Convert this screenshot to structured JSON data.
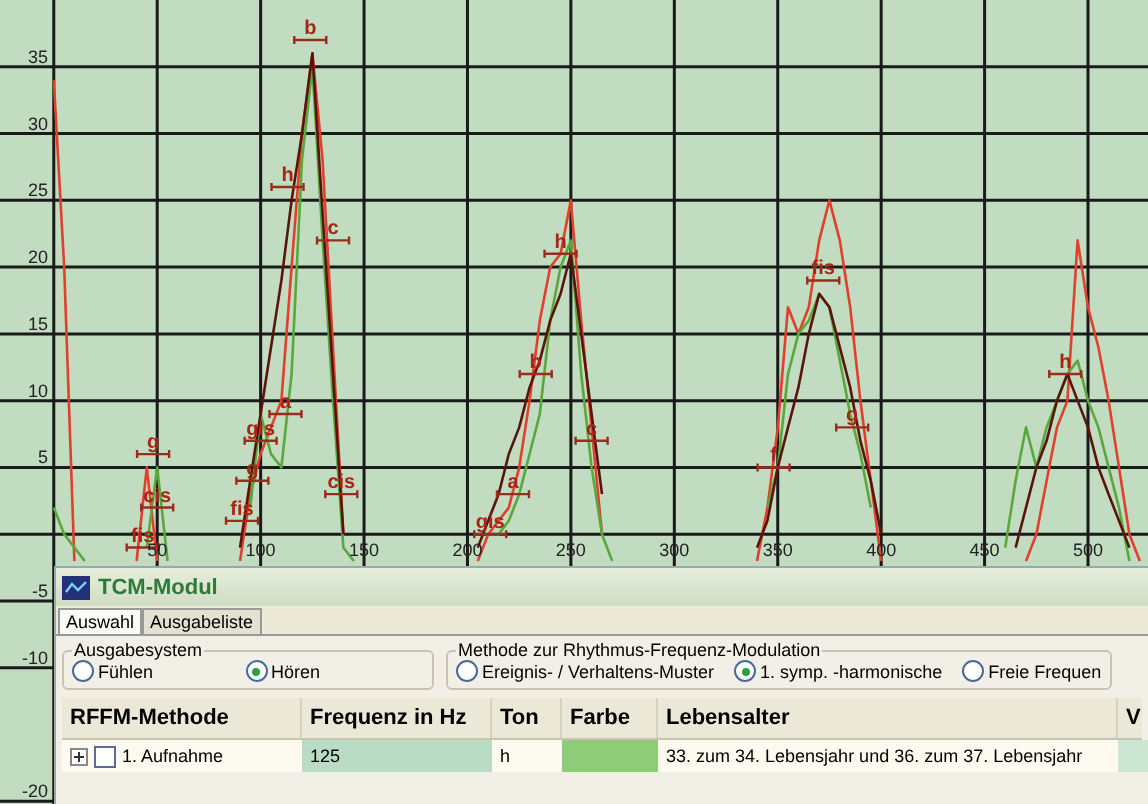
{
  "chart_data": {
    "type": "line",
    "xlim": [
      -26,
      529
    ],
    "ylim": [
      -20.2,
      40
    ],
    "xticks": [
      50,
      100,
      150,
      200,
      250,
      300,
      350,
      400,
      450,
      500
    ],
    "yticks": [
      -20,
      -10,
      -5,
      5,
      10,
      15,
      20,
      25,
      30,
      35
    ],
    "x": [
      0,
      5,
      10,
      15,
      40,
      45,
      50,
      55,
      90,
      95,
      100,
      105,
      110,
      115,
      120,
      125,
      130,
      135,
      140,
      145,
      205,
      210,
      215,
      220,
      225,
      230,
      235,
      240,
      245,
      250,
      255,
      260,
      265,
      270,
      340,
      345,
      350,
      355,
      360,
      365,
      370,
      375,
      380,
      385,
      390,
      395,
      400,
      460,
      465,
      470,
      475,
      480,
      485,
      490,
      495,
      500,
      505,
      510,
      515,
      520,
      525
    ],
    "series": [
      {
        "color": "#e0402c",
        "values": [
          34,
          20,
          -2,
          null,
          -2,
          5,
          -2,
          null,
          -2,
          3,
          6,
          8,
          10,
          20,
          30,
          36,
          28,
          14,
          0,
          null,
          -2,
          0,
          1,
          2,
          5,
          10,
          16,
          20,
          21,
          25,
          16,
          8,
          0,
          null,
          -2,
          2,
          8,
          17,
          15,
          17,
          22,
          25,
          22,
          17,
          10,
          4,
          -2,
          null,
          null,
          -2,
          0,
          4,
          8,
          10,
          22,
          17,
          14,
          10,
          5,
          0,
          -2
        ]
      },
      {
        "color": "#5aa83c",
        "values": [
          2,
          0,
          -1,
          -2,
          null,
          -1,
          5,
          -2,
          null,
          2,
          9,
          6,
          5,
          12,
          28,
          35,
          22,
          10,
          -1,
          -2,
          null,
          0,
          0,
          1,
          3,
          6,
          9,
          16,
          20,
          22,
          12,
          5,
          0,
          -2,
          null,
          2,
          5,
          12,
          15,
          16,
          18,
          17,
          13,
          9,
          6,
          2,
          null,
          -1,
          4,
          8,
          5,
          8,
          10,
          12,
          13,
          10,
          8,
          5,
          2,
          -2,
          null
        ]
      },
      {
        "color": "#5a140c",
        "values": [
          null,
          null,
          null,
          null,
          null,
          null,
          null,
          null,
          -1,
          4,
          9,
          14,
          19,
          25,
          30,
          36,
          24,
          12,
          0,
          null,
          -1,
          1,
          3,
          6,
          8,
          11,
          13,
          16,
          18,
          21,
          15,
          9,
          3,
          null,
          -1,
          1,
          5,
          8,
          11,
          15,
          18,
          17,
          14,
          11,
          7,
          4,
          0,
          null,
          -1,
          2,
          5,
          7,
          10,
          12,
          10,
          8,
          5,
          3,
          1,
          -1,
          null
        ]
      }
    ],
    "grid": true,
    "annotations": [
      "b",
      "h",
      "c",
      "cis",
      "a",
      "gis",
      "g",
      "fis",
      "g",
      "cis",
      "fis",
      "h",
      "b",
      "a",
      "gis",
      "c",
      "fis",
      "g",
      "f",
      "h"
    ]
  },
  "window": {
    "title": "TCM-Modul"
  },
  "tabs": [
    {
      "label": "Auswahl",
      "selected": true
    },
    {
      "label": "Ausgabeliste",
      "selected": false
    }
  ],
  "groups": [
    {
      "title": "Ausgabesystem",
      "options": [
        {
          "label": "Fühlen",
          "selected": false
        },
        {
          "label": "Hören",
          "selected": true
        }
      ]
    },
    {
      "title": "Methode zur Rhythmus-Frequenz-Modulation",
      "options": [
        {
          "label": "Ereignis- / Verhaltens-Muster",
          "selected": false
        },
        {
          "label": "1. symp. -harmonische",
          "selected": true
        },
        {
          "label": "Freie Frequen",
          "selected": false
        }
      ]
    }
  ],
  "table": {
    "columns": [
      "RFFM-Methode",
      "Frequenz in Hz",
      "Ton",
      "Farbe",
      "Lebensalter",
      "V"
    ],
    "rows": [
      {
        "expanded": false,
        "checked": false,
        "name": "1. Aufnahme",
        "frequency": "125",
        "tone": "h",
        "color": "#8fcc7a",
        "age": "33. zum 34. Lebensjahr und 36. zum 37. Lebensjahr"
      }
    ]
  }
}
